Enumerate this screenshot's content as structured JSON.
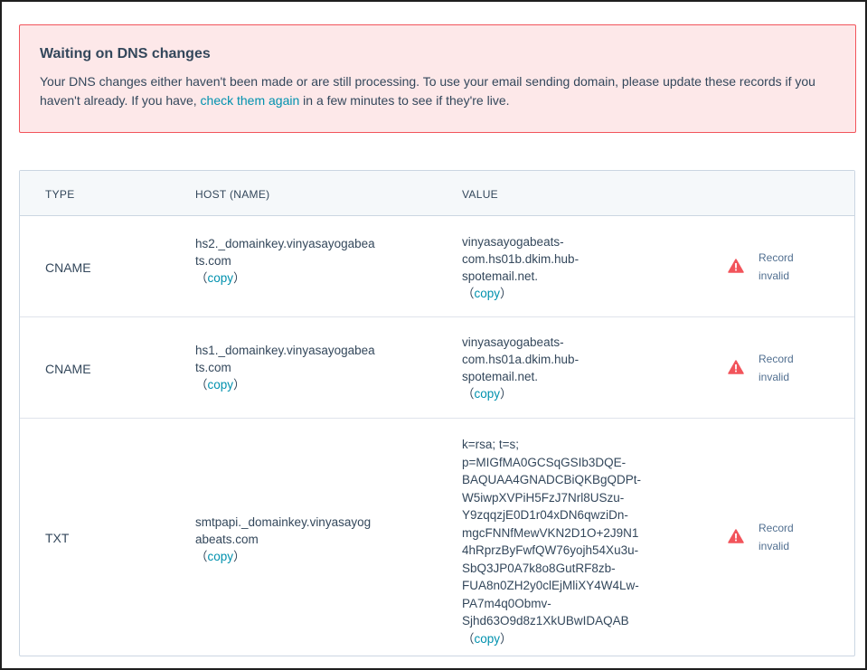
{
  "alert": {
    "title": "Waiting on DNS changes",
    "text_before_link": "Your DNS changes either haven't been made or are still processing. To use your email sending domain, please update these records if you haven't already. If you have, ",
    "link_text": "check them again",
    "text_after_link": " in a few minutes to see if they're live."
  },
  "table": {
    "headers": {
      "type": "TYPE",
      "host": "HOST (NAME)",
      "value": "VALUE"
    },
    "copy_open": "（",
    "copy_label": "copy",
    "copy_close": "）",
    "status_label_line1": "Record",
    "status_label_line2": "invalid",
    "rows": [
      {
        "type": "CNAME",
        "host_lines": [
          "hs2._domainkey.vinyasayogabea",
          "ts.com"
        ],
        "value_lines": [
          "vinyasayogabeats-",
          "com.hs01b.dkim.hub-",
          "spotemail.net."
        ]
      },
      {
        "type": "CNAME",
        "host_lines": [
          "hs1._domainkey.vinyasayogabea",
          "ts.com"
        ],
        "value_lines": [
          "vinyasayogabeats-",
          "com.hs01a.dkim.hub-",
          "spotemail.net."
        ]
      },
      {
        "type": "TXT",
        "host_lines": [
          "smtpapi._domainkey.vinyasayog",
          "abeats.com"
        ],
        "value_lines": [
          "k=rsa; t=s;",
          "p=MIGfMA0GCSqGSIb3DQE-",
          "BAQUAA4GNADCBiQKBgQDPt-",
          "W5iwpXVPiH5FzJ7Nrl8USzu-",
          "Y9zqqzjE0D1r04xDN6qwziDn-",
          "mgcFNNfMewVKN2D1O+2J9N1",
          "4hRprzByFwfQW76yojh54Xu3u-",
          "SbQ3JP0A7k8o8GutRF8zb-",
          "FUA8n0ZH2y0clEjMliXY4W4Lw-",
          "PA7m4q0Obmv-",
          "Sjhd63O9d8z1XkUBwIDAQAB"
        ]
      }
    ]
  },
  "colors": {
    "alert_bg": "#fde8e9",
    "alert_border": "#f2545b",
    "link": "#0091ae",
    "warning_icon": "#f2545b",
    "header_bg": "#f5f8fa"
  },
  "icons": {
    "status": "warning-triangle-icon"
  }
}
